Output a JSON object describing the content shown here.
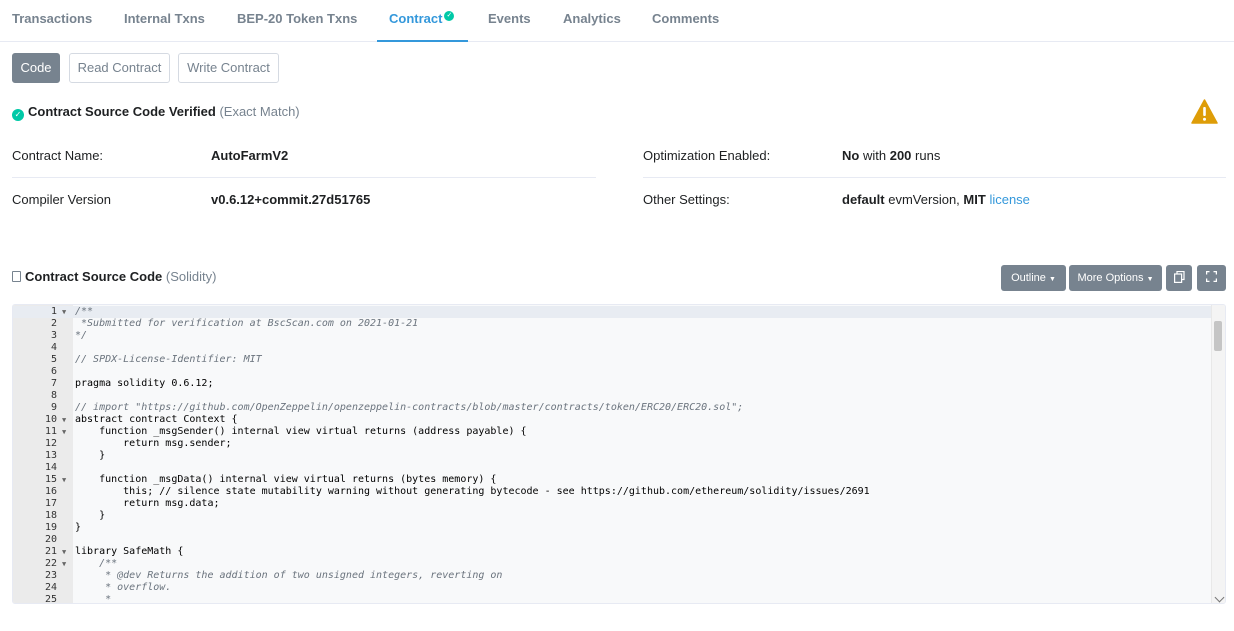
{
  "tabs": [
    {
      "label": "Transactions"
    },
    {
      "label": "Internal Txns"
    },
    {
      "label": "BEP-20 Token Txns"
    },
    {
      "label": "Contract"
    },
    {
      "label": "Events"
    },
    {
      "label": "Analytics"
    },
    {
      "label": "Comments"
    }
  ],
  "code_tabs": {
    "code": "Code",
    "read": "Read Contract",
    "write": "Write Contract"
  },
  "verified": {
    "title": "Contract Source Code Verified",
    "match": "(Exact Match)"
  },
  "info": {
    "contract_name_label": "Contract Name:",
    "contract_name": "AutoFarmV2",
    "compiler_label": "Compiler Version",
    "compiler": "v0.6.12+commit.27d51765",
    "optimization_label": "Optimization Enabled:",
    "optimization_value": "No",
    "optimization_with": "with",
    "optimization_runs": "200",
    "optimization_runs_suffix": "runs",
    "settings_label": "Other Settings:",
    "settings_default": "default",
    "settings_evm": "evmVersion,",
    "settings_license_type": "MIT",
    "settings_license_link": "license"
  },
  "source": {
    "title": "Contract Source Code",
    "lang": "(Solidity)",
    "outline_label": "Outline",
    "more_options_label": "More Options"
  },
  "colors": {
    "accent": "#3498db",
    "verified": "#00c9a7",
    "warning": "#de9d08"
  },
  "code_lines": [
    "/**",
    " *Submitted for verification at BscScan.com on 2021-01-21",
    "*/",
    "",
    "// SPDX-License-Identifier: MIT",
    "",
    "pragma solidity 0.6.12;",
    "",
    "// import \"https://github.com/OpenZeppelin/openzeppelin-contracts/blob/master/contracts/token/ERC20/ERC20.sol\";",
    "abstract contract Context {",
    "    function _msgSender() internal view virtual returns (address payable) {",
    "        return msg.sender;",
    "    }",
    "",
    "    function _msgData() internal view virtual returns (bytes memory) {",
    "        this; // silence state mutability warning without generating bytecode - see https://github.com/ethereum/solidity/issues/2691",
    "        return msg.data;",
    "    }",
    "}",
    "",
    "library SafeMath {",
    "    /**",
    "     * @dev Returns the addition of two unsigned integers, reverting on",
    "     * overflow.",
    "     *"
  ]
}
